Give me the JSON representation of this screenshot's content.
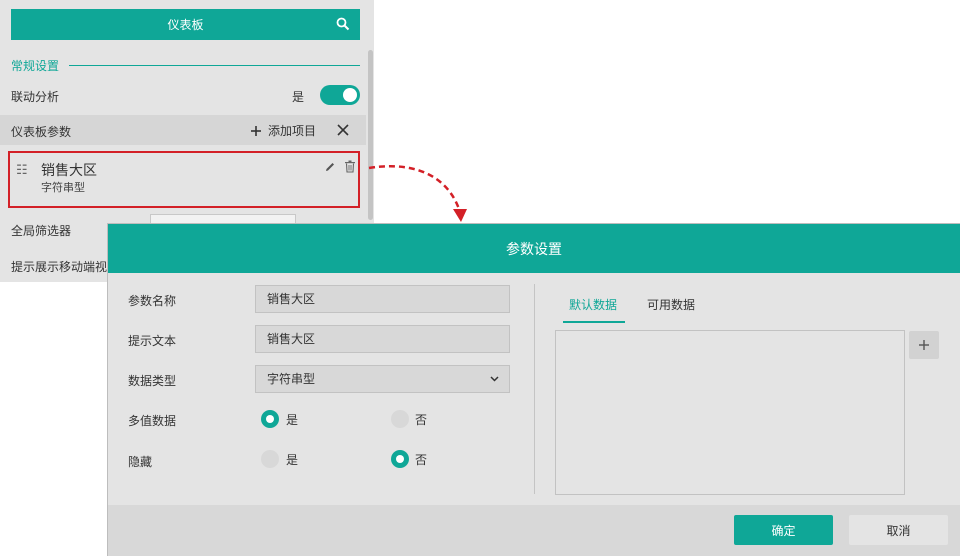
{
  "panel": {
    "title": "仪表板",
    "section_general": "常规设置",
    "linked_analysis": {
      "label": "联动分析",
      "value_text": "是",
      "enabled": true
    },
    "params_header": {
      "label": "仪表板参数",
      "add_label": "添加项目"
    },
    "param_item": {
      "name": "销售大区",
      "type": "字符串型"
    },
    "global_filter_label": "全局筛选器",
    "mobile_hint_label": "提示展示移动端视"
  },
  "dialog": {
    "title": "参数设置",
    "fields": {
      "param_name": {
        "label": "参数名称",
        "value": "销售大区"
      },
      "hint_text": {
        "label": "提示文本",
        "value": "销售大区"
      },
      "data_type": {
        "label": "数据类型",
        "value": "字符串型"
      },
      "multi_value": {
        "label": "多值数据",
        "yes": "是",
        "no": "否",
        "selected": "是"
      },
      "hidden": {
        "label": "隐藏",
        "yes": "是",
        "no": "否",
        "selected": "否"
      }
    },
    "tabs": [
      "默认数据",
      "可用数据"
    ],
    "active_tab": "默认数据",
    "ok_label": "确定",
    "cancel_label": "取消"
  },
  "colors": {
    "accent": "#0fa797",
    "highlight_border": "#d32027",
    "panel_bg": "#e4e4e4"
  },
  "icons": [
    "search-icon",
    "plus-icon",
    "close-icon",
    "drag-handle-icon",
    "edit-icon",
    "trash-icon",
    "chevron-down-icon"
  ]
}
